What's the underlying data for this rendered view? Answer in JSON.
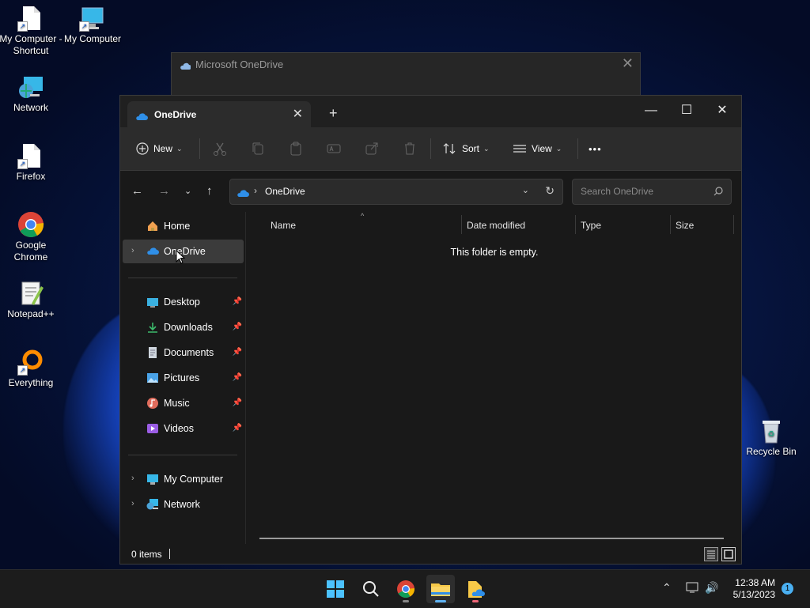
{
  "desktop": {
    "icons": [
      {
        "label": "My Computer - Shortcut",
        "icon": "document-shortcut-icon"
      },
      {
        "label": "My Computer",
        "icon": "computer-icon"
      },
      {
        "label": "Network",
        "icon": "network-icon"
      },
      {
        "label": "Firefox",
        "icon": "document-shortcut-icon"
      },
      {
        "label": "Google Chrome",
        "icon": "chrome-icon"
      },
      {
        "label": "Notepad++",
        "icon": "notepad-icon"
      },
      {
        "label": "Everything",
        "icon": "everything-icon"
      },
      {
        "label": "Recycle Bin",
        "icon": "recycle-bin-icon"
      }
    ]
  },
  "background_dialog": {
    "title": "Microsoft OneDrive"
  },
  "explorer": {
    "tab_title": "OneDrive",
    "toolbar": {
      "new_label": "New",
      "sort_label": "Sort",
      "view_label": "View",
      "more_label": "•••"
    },
    "address": {
      "crumb": "OneDrive"
    },
    "search": {
      "placeholder": "Search OneDrive"
    },
    "sidebar": {
      "home": "Home",
      "onedrive": "OneDrive",
      "pinned": [
        {
          "label": "Desktop",
          "icon": "desktop-folder-icon"
        },
        {
          "label": "Downloads",
          "icon": "downloads-icon"
        },
        {
          "label": "Documents",
          "icon": "documents-icon"
        },
        {
          "label": "Pictures",
          "icon": "pictures-icon"
        },
        {
          "label": "Music",
          "icon": "music-icon"
        },
        {
          "label": "Videos",
          "icon": "videos-icon"
        }
      ],
      "my_computer": "My Computer",
      "network": "Network"
    },
    "columns": {
      "name": "Name",
      "date_modified": "Date modified",
      "type": "Type",
      "size": "Size"
    },
    "empty_message": "This folder is empty.",
    "status": {
      "items": "0 items"
    }
  },
  "taskbar": {
    "apps": [
      "start-icon",
      "search-icon",
      "chrome-icon",
      "file-explorer-icon",
      "onedrive-folder-icon"
    ],
    "clock_time": "12:38 AM",
    "clock_date": "5/13/2023",
    "notification_count": "1"
  },
  "colors": {
    "accent": "#5fb2f2",
    "window_bg": "#191919",
    "toolbar_bg": "#2c2c2c"
  }
}
